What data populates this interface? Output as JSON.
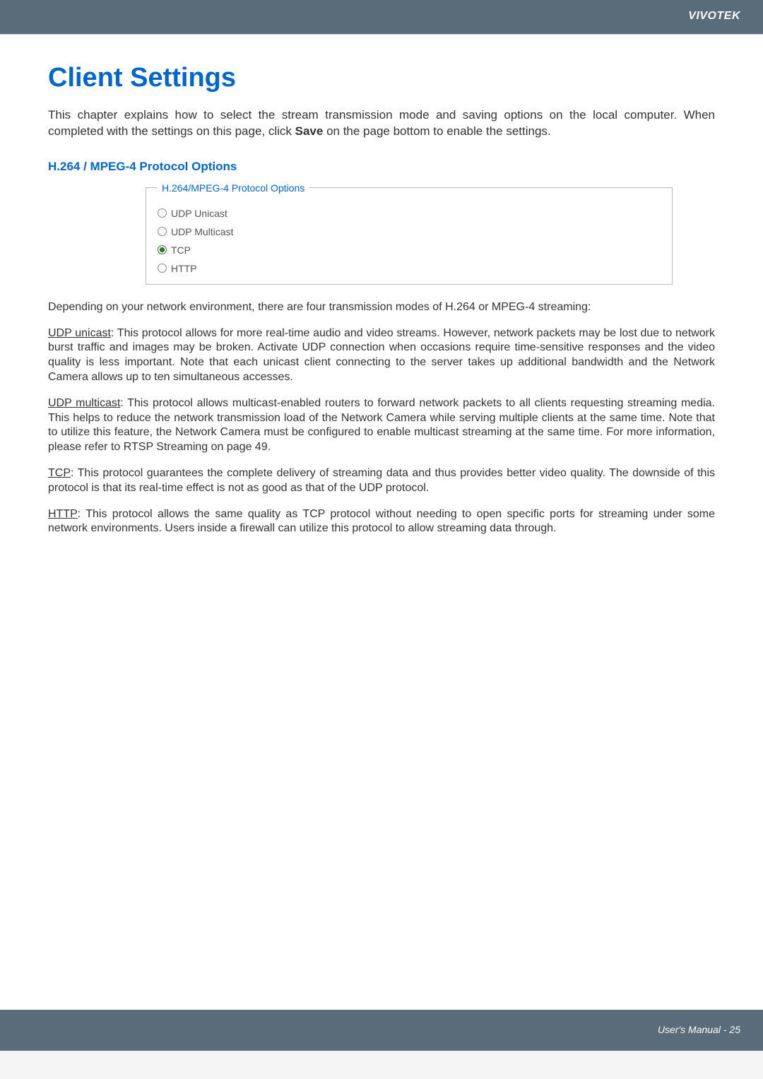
{
  "header": {
    "brand": "VIVOTEK"
  },
  "title": "Client Settings",
  "intro": {
    "pre_bold": "This chapter explains how to select the stream transmission mode and saving options on the local computer. When completed with the settings on this page, click ",
    "bold": "Save",
    "post_bold": " on the page bottom to enable the settings."
  },
  "section_subtitle": "H.264 / MPEG-4 Protocol Options",
  "fieldset": {
    "legend": "H.264/MPEG-4 Protocol Options",
    "options": [
      {
        "label": "UDP Unicast",
        "selected": false
      },
      {
        "label": "UDP Multicast",
        "selected": false
      },
      {
        "label": "TCP",
        "selected": true
      },
      {
        "label": "HTTP",
        "selected": false
      }
    ]
  },
  "para_depending": "Depending on your network environment, there are four transmission modes of H.264 or MPEG-4 streaming:",
  "udp_unicast": {
    "label": "UDP unicast",
    "text": ": This protocol allows for more real-time audio and video streams. However, network packets may be lost due to network burst traffic and images may be broken. Activate UDP connection when occasions require time-sensitive responses and the video quality is less important. Note that each unicast client connecting to the server takes up additional bandwidth and the Network Camera allows up to ten simultaneous accesses."
  },
  "udp_multicast": {
    "label": "UDP multicast",
    "text": ": This protocol allows multicast-enabled routers to forward network packets to all clients requesting streaming media. This helps to reduce the network transmission load of the Network Camera while serving multiple clients at the same time. Note that to utilize this feature, the Network Camera must be configured to enable multicast streaming at the same time. For more information, please refer to RTSP Streaming on page 49."
  },
  "tcp": {
    "label": "TCP",
    "text": ": This protocol guarantees the complete delivery of streaming data and thus provides better video quality. The downside of this protocol is that its real-time effect is not as good as that of the UDP protocol."
  },
  "http": {
    "label": "HTTP",
    "text": ": This protocol allows the same quality as TCP protocol without needing to open specific ports for streaming under some network environments. Users inside a firewall can utilize this protocol to allow streaming data through."
  },
  "footer": {
    "text": "User's Manual - 25"
  }
}
